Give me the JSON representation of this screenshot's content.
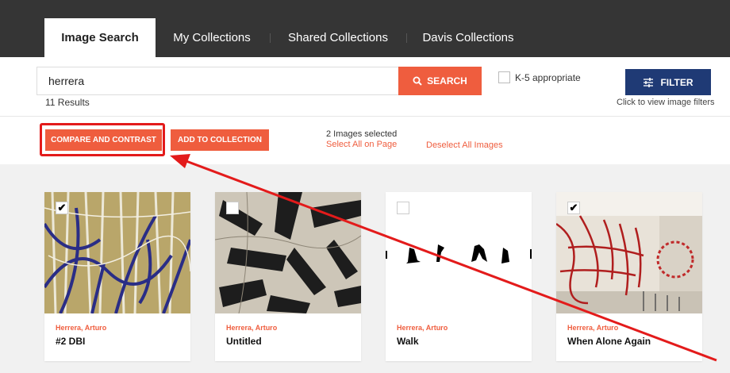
{
  "nav": {
    "tabs": [
      {
        "label": "Image Search",
        "active": true
      },
      {
        "label": "My Collections",
        "active": false
      },
      {
        "label": "Shared Collections",
        "active": false
      },
      {
        "label": "Davis Collections",
        "active": false
      }
    ]
  },
  "search": {
    "value": "herrera",
    "button_label": "SEARCH",
    "button_icon": "search-icon",
    "results_count": "11 Results"
  },
  "k5": {
    "label": "K-5 appropriate",
    "checked": false
  },
  "filter": {
    "button_label": "FILTER",
    "icon": "sliders-icon",
    "hint": "Click to view image filters"
  },
  "actions": {
    "compare_label": "COMPARE AND CONTRAST",
    "add_label": "ADD TO COLLECTION",
    "selected_text": "2 Images selected",
    "select_all": "Select All on Page",
    "deselect_all": "Deselect All Images"
  },
  "cards": [
    {
      "artist": "Herrera, Arturo",
      "title": "#2 DBI",
      "checked": true
    },
    {
      "artist": "Herrera, Arturo",
      "title": "Untitled",
      "checked": false
    },
    {
      "artist": "Herrera, Arturo",
      "title": "Walk",
      "checked": false
    },
    {
      "artist": "Herrera, Arturo",
      "title": "When Alone Again",
      "checked": true
    }
  ],
  "colors": {
    "accent": "#ef5d3e",
    "nav_bg": "#353535",
    "filter_bg": "#1f3a75",
    "annotation": "#e31b1b"
  }
}
